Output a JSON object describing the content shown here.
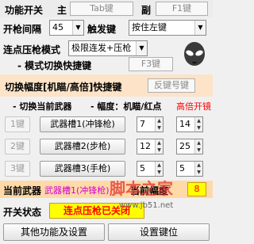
{
  "header": {
    "function_switch_label": "功能开关",
    "main_label": "主",
    "main_key": "Tab键",
    "secondary_label": "副",
    "secondary_key": "F1键"
  },
  "fire": {
    "interval_label": "开枪间隔",
    "interval_value": "45",
    "trigger_label": "触发键",
    "trigger_value": "按住左键"
  },
  "mode": {
    "label": "连点压枪模式",
    "value": "极限连发+压枪",
    "switch_label": "- 模式切换快捷键",
    "switch_key": "F3键"
  },
  "amplitude": {
    "label": "切换幅度[机瞄/高倍]快捷键",
    "key": "反键号键"
  },
  "weapons_header": {
    "left": "- 切换当前武器",
    "middle": "- 幅度：机瞄/红点",
    "right": "高倍开镜"
  },
  "weapons": [
    {
      "key": "1键",
      "name": "武器槽1(冲锋枪)",
      "v1": "7",
      "v2": "14"
    },
    {
      "key": "2键",
      "name": "武器槽2(步枪)",
      "v1": "12",
      "v2": "25"
    },
    {
      "key": "3键",
      "name": "武器槽3(手枪)",
      "v1": "5",
      "v2": "5"
    }
  ],
  "current": {
    "label": "当前武器",
    "value": "武器槽1(冲锋枪)",
    "amp_label": "当前幅度",
    "amp_value": "8"
  },
  "status": {
    "label": "开关状态",
    "value": "连点压枪已关闭"
  },
  "footer": {
    "other_button": "其他功能及设置",
    "keys_button": "设置键位"
  },
  "watermark": {
    "brand": "脚本之家",
    "url": "www.jb51.net"
  },
  "colors": {
    "accent_red": "#ff0000",
    "status_bg": "#ffff00",
    "amp_strip": "#fde3c8",
    "current_strip": "#ffd9a8"
  }
}
